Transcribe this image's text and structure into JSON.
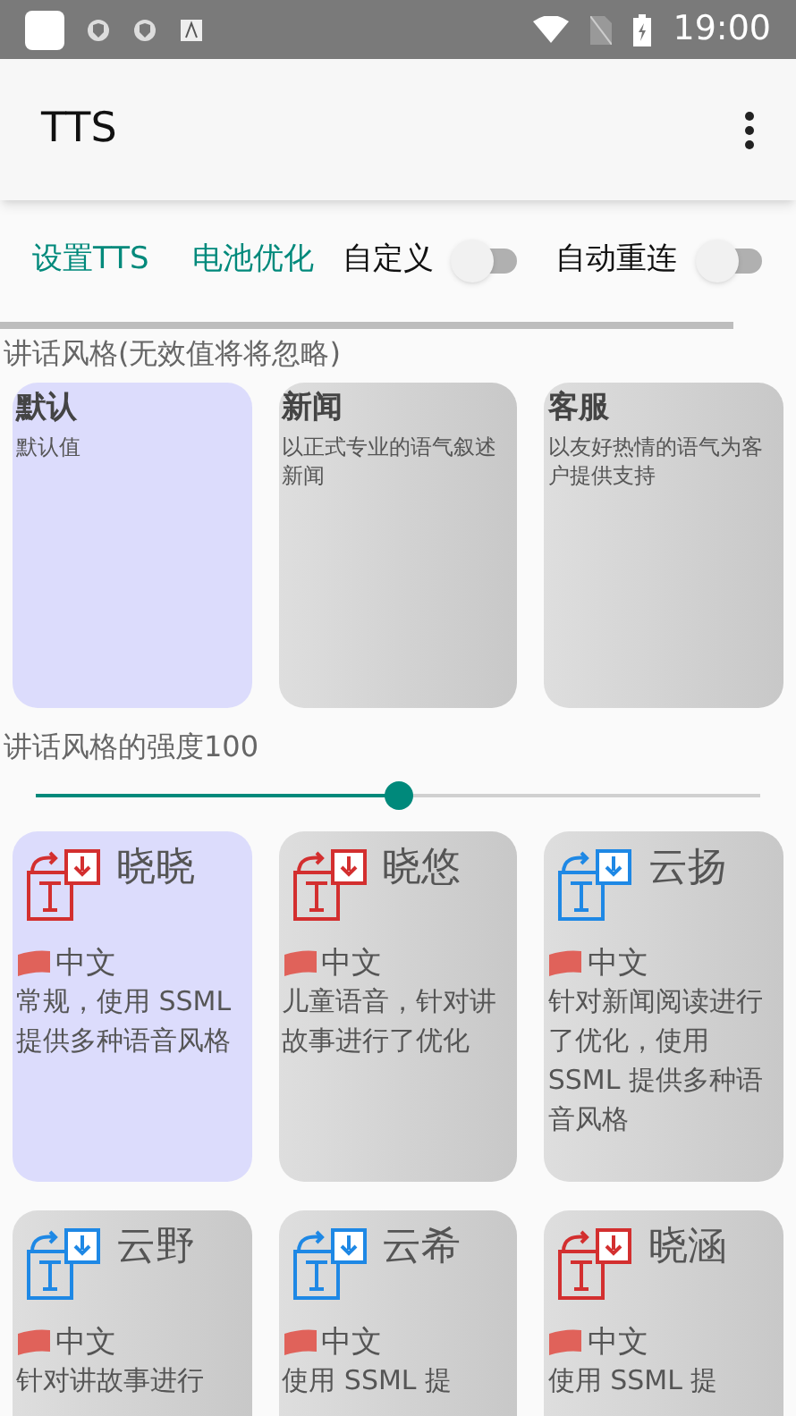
{
  "status_bar": {
    "time": "19:00"
  },
  "app_bar": {
    "title": "TTS"
  },
  "actions": [
    {
      "kind": "link",
      "label": "设置TTS"
    },
    {
      "kind": "link",
      "label": "电池优化"
    },
    {
      "kind": "switch",
      "label": "自定义",
      "on": false
    },
    {
      "kind": "switch",
      "label": "自动重连",
      "on": false
    }
  ],
  "styles": {
    "label": "讲话风格(无效值将将忽略)",
    "items": [
      {
        "name": "默认",
        "desc": "默认值",
        "selected": true
      },
      {
        "name": "新闻",
        "desc": "以正式专业的语气叙述新闻",
        "selected": false
      },
      {
        "name": "客服",
        "desc": "以友好热情的语气为客户提供支持",
        "selected": false
      }
    ]
  },
  "intensity": {
    "label": "讲话风格的强度100",
    "level": 0.5
  },
  "voices": [
    {
      "name": "晓晓",
      "lang": "中文",
      "desc": "常规，使用 SSML 提供多种语音风格",
      "color": "#d32f2f",
      "selected": true
    },
    {
      "name": "晓悠",
      "lang": "中文",
      "desc": "儿童语音，针对讲故事进行了优化",
      "color": "#d32f2f",
      "selected": false
    },
    {
      "name": "云扬",
      "lang": "中文",
      "desc": "针对新闻阅读进行了优化，使用 SSML 提供多种语音风格",
      "color": "#1e88e5",
      "selected": false
    },
    {
      "name": "云野",
      "lang": "中文",
      "desc": "针对讲故事进行",
      "color": "#1e88e5",
      "selected": false
    },
    {
      "name": "云希",
      "lang": "中文",
      "desc": "使用 SSML 提",
      "color": "#1e88e5",
      "selected": false
    },
    {
      "name": "晓涵",
      "lang": "中文",
      "desc": "使用 SSML 提",
      "color": "#d32f2f",
      "selected": false
    }
  ]
}
